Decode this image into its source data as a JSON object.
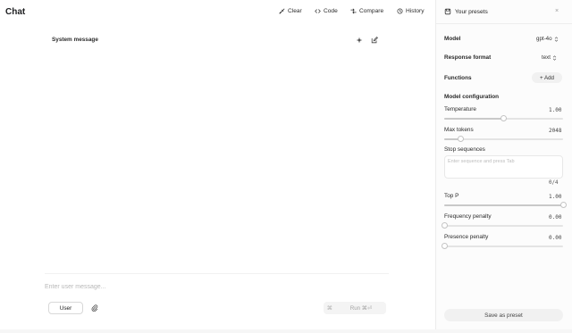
{
  "app": {
    "title": "Chat"
  },
  "header": {
    "clear_label": "Clear",
    "code_label": "Code",
    "compare_label": "Compare",
    "history_label": "History"
  },
  "main": {
    "system_message_label": "System message",
    "user_placeholder": "Enter user message...",
    "role_label": "User",
    "run_separator": "⌘",
    "run_label": "Run ⌘⏎"
  },
  "panel": {
    "presets_label": "Your presets",
    "model_label": "Model",
    "model_value": "gpt-4o",
    "response_format_label": "Response format",
    "response_format_value": "text",
    "functions_label": "Functions",
    "add_label": "+ Add",
    "model_config_label": "Model configuration",
    "temperature_label": "Temperature",
    "temperature_value": "1.00",
    "temperature_fraction": 0.5,
    "max_tokens_label": "Max tokens",
    "max_tokens_value": "2048",
    "max_tokens_fraction": 0.14,
    "stop_sequences_label": "Stop sequences",
    "stop_sequences_placeholder": "Enter sequence and press Tab",
    "stop_sequences_count": "0/4",
    "top_p_label": "Top P",
    "top_p_value": "1.00",
    "top_p_fraction": 1.0,
    "frequency_penalty_label": "Frequency penalty",
    "frequency_penalty_value": "0.00",
    "frequency_penalty_fraction": 0.0,
    "presence_penalty_label": "Presence penalty",
    "presence_penalty_value": "0.00",
    "presence_penalty_fraction": 0.0,
    "save_preset_label": "Save as preset"
  },
  "icons": [
    "clear-icon",
    "code-icon",
    "compare-icon",
    "history-icon",
    "sparkle-icon",
    "edit-icon",
    "paperclip-icon",
    "presets-icon",
    "close-icon",
    "chevron-updown-icon"
  ],
  "colors": {
    "text": "#202123",
    "muted": "#a3a3a3",
    "panel_bg": "#fcfcfc",
    "button_bg": "#f1f1f1"
  }
}
